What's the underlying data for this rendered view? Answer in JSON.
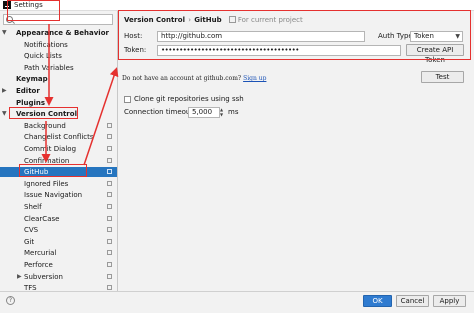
{
  "window": {
    "title": "Settings"
  },
  "sidebar": {
    "search_placeholder": "",
    "items": [
      {
        "label": "Appearance & Behavior",
        "bold": true,
        "level": 0,
        "arrow": "down"
      },
      {
        "label": "Notifications",
        "level": 1
      },
      {
        "label": "Quick Lists",
        "level": 1
      },
      {
        "label": "Path Variables",
        "level": 1
      },
      {
        "label": "Keymap",
        "bold": true,
        "level": 0
      },
      {
        "label": "Editor",
        "bold": true,
        "level": 0,
        "arrow": "right"
      },
      {
        "label": "Plugins",
        "bold": true,
        "level": 0
      },
      {
        "label": "Version Control",
        "bold": true,
        "level": 0,
        "arrow": "down"
      },
      {
        "label": "Background",
        "level": 1,
        "project": true
      },
      {
        "label": "Changelist Conflicts",
        "level": 1,
        "project": true
      },
      {
        "label": "Commit Dialog",
        "level": 1,
        "project": true
      },
      {
        "label": "Confirmation",
        "level": 1,
        "project": true
      },
      {
        "label": "GitHub",
        "level": 1,
        "project": true,
        "selected": true
      },
      {
        "label": "Ignored Files",
        "level": 1,
        "project": true
      },
      {
        "label": "Issue Navigation",
        "level": 1,
        "project": true
      },
      {
        "label": "Shelf",
        "level": 1,
        "project": true
      },
      {
        "label": "ClearCase",
        "level": 1,
        "project": true
      },
      {
        "label": "CVS",
        "level": 1,
        "project": true
      },
      {
        "label": "Git",
        "level": 1,
        "project": true
      },
      {
        "label": "Mercurial",
        "level": 1,
        "project": true
      },
      {
        "label": "Perforce",
        "level": 1,
        "project": true
      },
      {
        "label": "Subversion",
        "level": 1,
        "project": true,
        "arrow": "right"
      },
      {
        "label": "TFS",
        "level": 1,
        "project": true
      }
    ]
  },
  "content": {
    "breadcrumb": [
      "Version Control",
      "GitHub"
    ],
    "breadcrumb_sep": "›",
    "current_project": "For current project",
    "host_label": "Host:",
    "host_value": "http://github.com",
    "auth_label": "Auth Type:",
    "auth_value": "Token",
    "token_label": "Token:",
    "token_value": "••••••••••••••••••••••••••••••••••••••",
    "create_token_label": "Create API Token",
    "no_account_text": "Do not have an account at github.com?",
    "signup_label": "Sign up",
    "test_label": "Test",
    "clone_ssh_label": "Clone git repositories using ssh",
    "clone_ssh_checked": false,
    "timeout_label": "Connection timeout:",
    "timeout_value": "5,000",
    "timeout_unit": "ms"
  },
  "footer": {
    "help_glyph": "?",
    "ok_label": "OK",
    "cancel_label": "Cancel",
    "apply_label": "Apply"
  },
  "colors": {
    "selection": "#2675bf",
    "annotation": "#e5312f",
    "primary_button": "#2f7bd0"
  }
}
